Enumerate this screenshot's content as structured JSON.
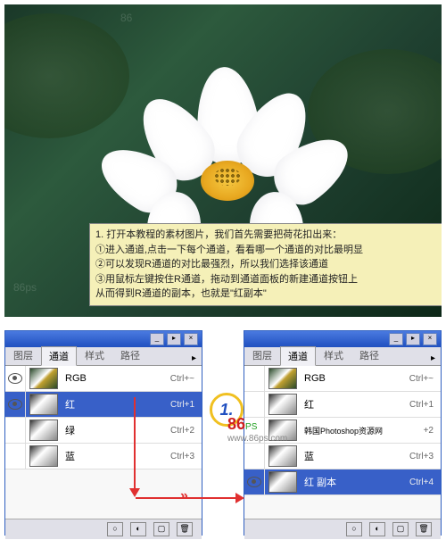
{
  "watermarks": {
    "wm1": "86ps",
    "wm2": "86"
  },
  "instructions": {
    "line1": "1. 打开本教程的素材图片，我们首先需要把荷花扣出来：",
    "line2": "①进入通道,点击一下每个通道，看看哪一个通道的对比最明显",
    "line3": "②可以发现R通道的对比最强烈，所以我们选择该通道",
    "line4": "③用鼠标左键按住R通道，拖动到通道面板的新建通道按钮上",
    "line5": "   从而得到R通道的副本，也就是\"红副本\""
  },
  "step_number": "1.",
  "titlebar": {
    "min": "_",
    "arrow": "▸",
    "close": "×"
  },
  "tabs": {
    "layers": "图层",
    "channels": "通道",
    "styles": "样式",
    "paths": "路径",
    "dropdown": "▸"
  },
  "panel_left": {
    "channels": [
      {
        "name": "RGB",
        "shortcut": "Ctrl+~",
        "eye": true,
        "color": true
      },
      {
        "name": "红",
        "shortcut": "Ctrl+1",
        "eye": true,
        "color": false,
        "selected": true
      },
      {
        "name": "绿",
        "shortcut": "Ctrl+2",
        "eye": false,
        "color": false
      },
      {
        "name": "蓝",
        "shortcut": "Ctrl+3",
        "eye": false,
        "color": false
      }
    ]
  },
  "panel_right": {
    "channels": [
      {
        "name": "RGB",
        "shortcut": "Ctrl+~",
        "eye": false,
        "color": true
      },
      {
        "name": "红",
        "shortcut": "Ctrl+1",
        "eye": false,
        "color": false
      },
      {
        "name": "韩国Photoshop资源网",
        "shortcut": "+2",
        "eye": false,
        "color": false
      },
      {
        "name": "蓝",
        "shortcut": "Ctrl+3",
        "eye": false,
        "color": false
      },
      {
        "name": "红 副本",
        "shortcut": "Ctrl+4",
        "eye": true,
        "color": false,
        "selected": true
      }
    ]
  },
  "footer_icons": {
    "circle": "○",
    "mask": "◐",
    "new": "▢",
    "trash": "🗑"
  },
  "logo": {
    "brand": "86",
    "ps": "PS",
    "url": "www.86ps.com"
  }
}
